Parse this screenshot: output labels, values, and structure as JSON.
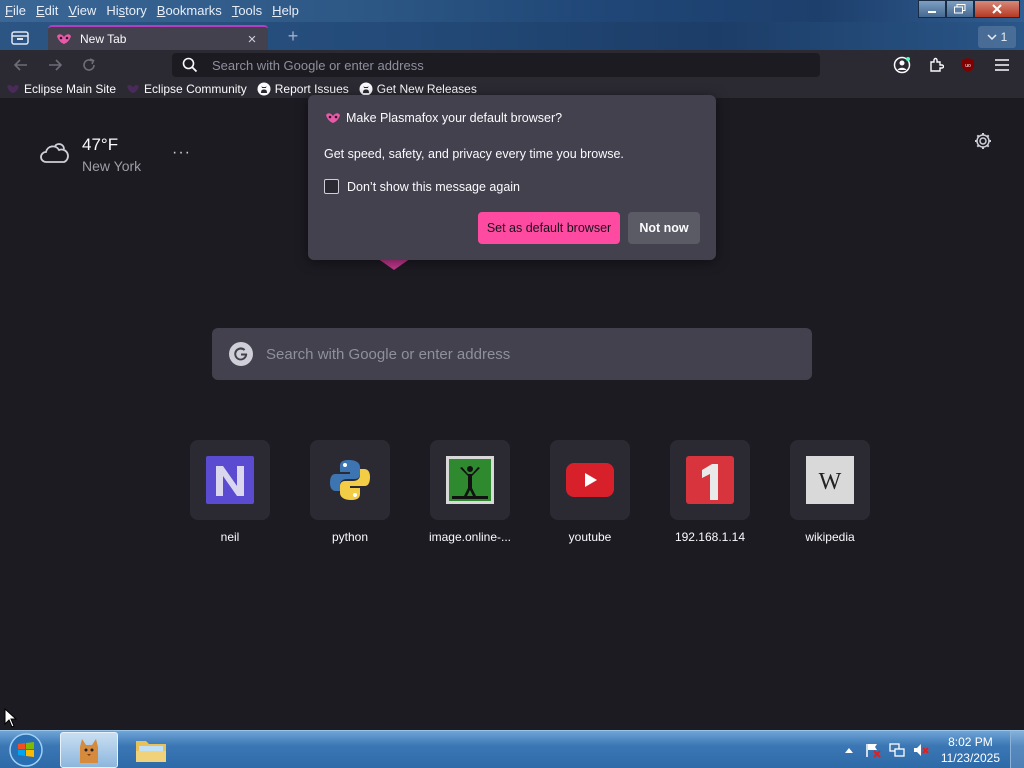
{
  "menu": {
    "file": {
      "u": "F",
      "rest": "ile"
    },
    "edit": {
      "u": "E",
      "rest": "dit"
    },
    "view": {
      "u": "V",
      "rest": "iew"
    },
    "history": {
      "pre": "Hi",
      "u": "s",
      "rest": "tory"
    },
    "bookmarks": {
      "u": "B",
      "rest": "ookmarks"
    },
    "tools": {
      "u": "T",
      "rest": "ools"
    },
    "help": {
      "u": "H",
      "rest": "elp"
    }
  },
  "tabs": {
    "active_title": "New Tab",
    "tab_count": "1"
  },
  "urlbar": {
    "placeholder": "Search with Google or enter address"
  },
  "bookmarks_bar": [
    {
      "label": "Eclipse Main Site",
      "icon": "plasmafox-icon"
    },
    {
      "label": "Eclipse Community",
      "icon": "plasmafox-icon"
    },
    {
      "label": "Report Issues",
      "icon": "github-icon"
    },
    {
      "label": "Get New Releases",
      "icon": "github-icon"
    }
  ],
  "weather": {
    "temperature": "47°F",
    "city": "New York",
    "menu": "···"
  },
  "search": {
    "placeholder": "Search with Google or enter address"
  },
  "top_sites": [
    {
      "label": "neil",
      "icon": "neil-icon"
    },
    {
      "label": "python",
      "icon": "python-icon"
    },
    {
      "label": "image.online-...",
      "icon": "image-online-icon"
    },
    {
      "label": "youtube",
      "icon": "youtube-icon"
    },
    {
      "label": "192.168.1.14",
      "icon": "router-icon"
    },
    {
      "label": "wikipedia",
      "icon": "wikipedia-icon"
    }
  ],
  "dialog": {
    "title": "Make Plasmafox your default browser?",
    "body": "Get speed, safety, and privacy every time you browse.",
    "checkbox_label": "Don’t show this message again",
    "primary_button": "Set as default browser",
    "secondary_button": "Not now"
  },
  "taskbar": {
    "time": "8:02 PM",
    "date": "11/23/2025"
  },
  "colors": {
    "accent_pink": "#ff4aa2",
    "background": "#1c1b22",
    "panel": "#42414d"
  }
}
